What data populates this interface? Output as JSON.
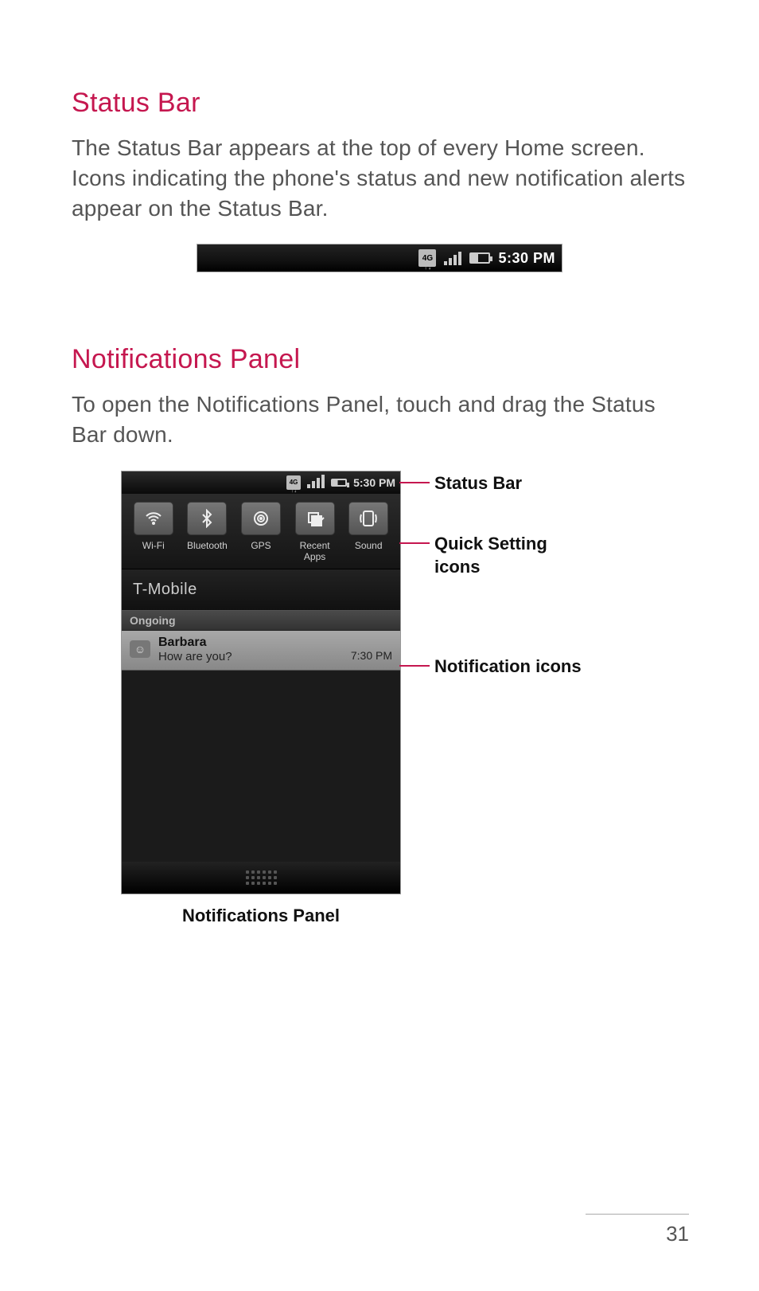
{
  "section1": {
    "heading": "Status Bar",
    "body": "The Status Bar appears at the top of every Home screen. Icons indicating the phone's status and new notification alerts appear on the Status Bar."
  },
  "statusbar_small": {
    "network_label": "4G",
    "time": "5:30 PM"
  },
  "section2": {
    "heading": "Notifications Panel",
    "body": "To open the Notifications Panel, touch and drag the Status Bar down."
  },
  "panel": {
    "status_time": "5:30 PM",
    "quick_settings": [
      {
        "label": "Wi-Fi"
      },
      {
        "label": "Bluetooth"
      },
      {
        "label": "GPS"
      },
      {
        "label": "Recent Apps"
      },
      {
        "label": "Sound"
      }
    ],
    "carrier": "T-Mobile",
    "section_label": "Ongoing",
    "notification": {
      "title": "Barbara",
      "subtitle": "How are you?",
      "time": "7:30 PM"
    }
  },
  "annotations": {
    "statusbar": "Status Bar",
    "quick_settings": "Quick Setting icons",
    "notification": "Notification icons"
  },
  "caption": "Notifications Panel",
  "page_number": "31"
}
